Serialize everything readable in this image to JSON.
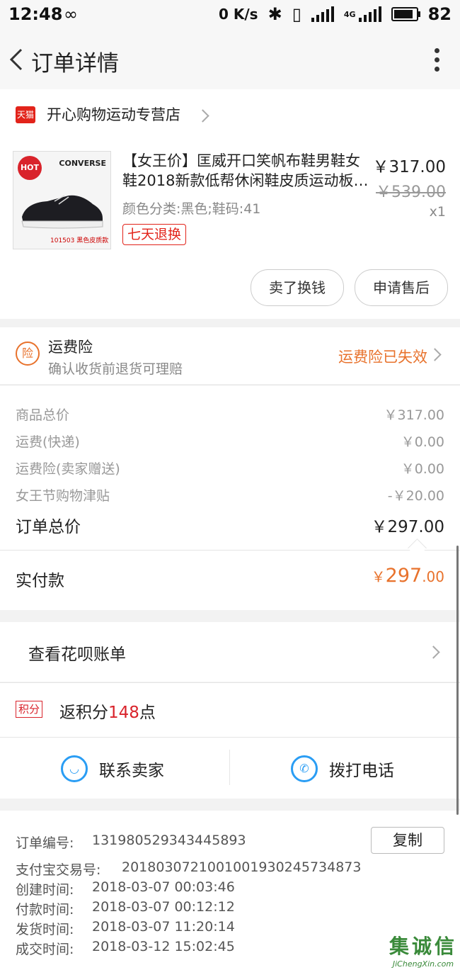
{
  "status": {
    "time": "12:48",
    "net_speed": "0 K/s",
    "network": "4G",
    "battery": "82"
  },
  "header": {
    "title": "订单详情"
  },
  "shop": {
    "platform_badge": "天猫",
    "name": "开心购物运动专营店"
  },
  "product": {
    "badge": "HOT",
    "brand": "CONVERSE",
    "image_caption": "101503 黑色皮质款",
    "title": "【女王价】匡威开口笑帆布鞋男鞋女鞋2018新款低帮休闲鞋皮质运动板…",
    "sku": "颜色分类:黑色;鞋码:41",
    "tag": "七天退换",
    "price": "￥317.00",
    "original_price": "￥539.00",
    "quantity": "x1"
  },
  "actions": {
    "sell": "卖了换钱",
    "after_sale": "申请售后"
  },
  "insurance": {
    "icon": "险",
    "title": "运费险",
    "subtitle": "确认收货前退货可理赔",
    "status": "运费险已失效"
  },
  "breakdown": {
    "rows": [
      {
        "label": "商品总价",
        "value": "￥317.00"
      },
      {
        "label": "运费(快递)",
        "value": "￥0.00"
      },
      {
        "label": "运费险(卖家赠送)",
        "value": "￥0.00"
      },
      {
        "label": "女王节购物津贴",
        "value": "-￥20.00"
      }
    ],
    "total_label": "订单总价",
    "total_value": "￥297.00"
  },
  "paid": {
    "label": "实付款",
    "currency": "￥",
    "integer": "297",
    "decimal": ".00"
  },
  "huabei": {
    "label": "查看花呗账单"
  },
  "points": {
    "tag": "积分",
    "prefix": "返积分",
    "num": "148",
    "suffix": "点"
  },
  "contact": {
    "seller": "联系卖家",
    "phone": "拨打电话"
  },
  "order_info": {
    "copy": "复制",
    "rows": [
      {
        "label": "订单编号:",
        "value": "131980529343445893"
      },
      {
        "label": "支付宝交易号:",
        "value": "2018030721001001930245734873"
      },
      {
        "label": "创建时间:",
        "value": "2018-03-07 00:03:46"
      },
      {
        "label": "付款时间:",
        "value": "2018-03-07 00:12:12"
      },
      {
        "label": "发货时间:",
        "value": "2018-03-07 11:20:14"
      },
      {
        "label": "成交时间:",
        "value": "2018-03-12 15:02:45"
      }
    ]
  },
  "watermark": {
    "text": "集诚信",
    "url": "JiChengXin.com"
  },
  "colors": {
    "accent": "#e8722c",
    "tmall_red": "#e2231a",
    "points_red": "#d9232b",
    "link_blue": "#2a9df4"
  }
}
